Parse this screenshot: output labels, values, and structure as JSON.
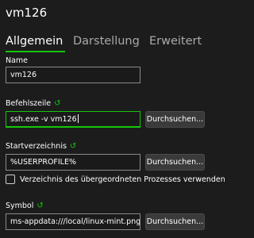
{
  "profile_title": "vm126",
  "tabs": [
    {
      "label": "Allgemein",
      "active": true
    },
    {
      "label": "Darstellung",
      "active": false
    },
    {
      "label": "Erweitert",
      "active": false
    }
  ],
  "fields": {
    "name": {
      "label": "Name",
      "value": "vm126"
    },
    "command_line": {
      "label": "Befehlszeile",
      "value": "ssh.exe -v vm126",
      "button": "Durchsuchen..."
    },
    "start_directory": {
      "label": "Startverzeichnis",
      "value": "%USERPROFILE%",
      "button": "Durchsuchen...",
      "checkbox_label": "Verzeichnis des übergeordneten Prozesses verwenden",
      "checkbox_checked": false
    },
    "icon": {
      "label": "Symbol",
      "value": "ms-appdata:///local/linux-mint.png",
      "button": "Durchsuchen..."
    }
  },
  "colors": {
    "accent": "#16c60c",
    "background": "#1c1c1c",
    "button": "#3a3a3a"
  },
  "icons": {
    "reset": "reset-icon"
  }
}
